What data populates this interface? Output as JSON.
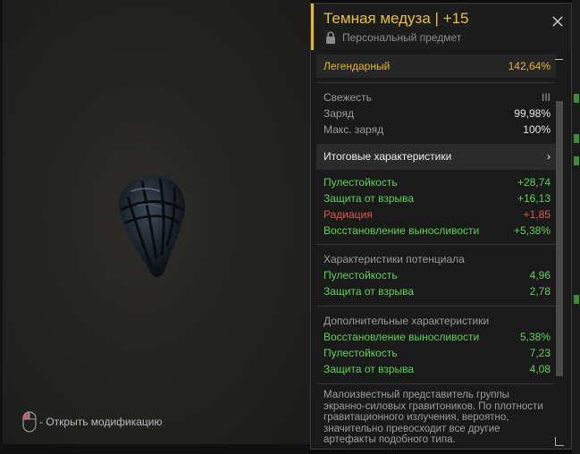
{
  "viewer": {
    "hint_text": "- Открыть модификацию",
    "artifact_icon": "jellyfish-artifact"
  },
  "item": {
    "title": "Темная медуза | +15",
    "subtitle": "Персональный предмет",
    "rarity": {
      "label": "Легендарный",
      "value": "142,64%"
    },
    "base_stats": [
      {
        "label": "Свежесть",
        "value": "III"
      },
      {
        "label": "Заряд",
        "value": "99,98%"
      },
      {
        "label": "Макс. заряд",
        "value": "100%"
      }
    ],
    "totals_label": "Итоговые характеристики",
    "final_stats": [
      {
        "label": "Пулестойкость",
        "value": "+28,74",
        "tone": "positive"
      },
      {
        "label": "Защита от взрыва",
        "value": "+16,13",
        "tone": "positive"
      },
      {
        "label": "Радиация",
        "value": "+1,85",
        "tone": "negative"
      },
      {
        "label": "Восстановление выносливости",
        "value": "+5,38%",
        "tone": "positive"
      }
    ],
    "potential": {
      "heading": "Характеристики потенциала",
      "stats": [
        {
          "label": "Пулестойкость",
          "value": "4,96"
        },
        {
          "label": "Защита от взрыва",
          "value": "2,78"
        }
      ]
    },
    "additional": {
      "heading": "Дополнительные характеристики",
      "stats": [
        {
          "label": "Восстановление выносливости",
          "value": "5,38%"
        },
        {
          "label": "Пулестойкость",
          "value": "7,23"
        },
        {
          "label": "Защита от взрыва",
          "value": "4,08"
        }
      ]
    },
    "description": "Малоизвестный представитель группы экранно-силовых гравитоников. По плотности гравитационного излучения, вероятно, значительно превосходит все другие артефакты подобного типа."
  },
  "colors": {
    "accent": "#e8b824",
    "positive": "#5fd155",
    "negative": "#e05454",
    "legendary": "#e3b52d"
  }
}
